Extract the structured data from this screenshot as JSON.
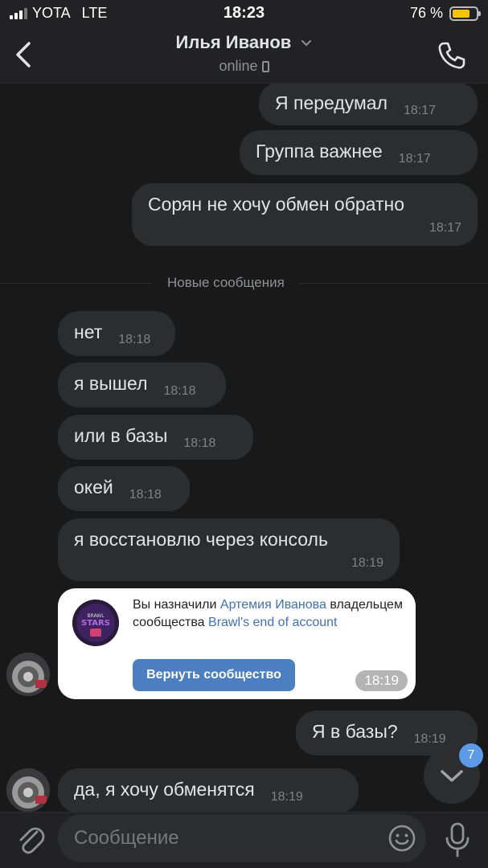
{
  "status_bar": {
    "carrier": "YOTA",
    "network": "LTE",
    "time": "18:23",
    "battery": "76 %",
    "battery_level": 0.76
  },
  "header": {
    "title": "Илья Иванов",
    "status": "online"
  },
  "messages_out_top": [
    {
      "text": "Я передумал",
      "time": "18:17"
    },
    {
      "text": "Группа важнее",
      "time": "18:17"
    },
    {
      "text": "Сорян не хочу обмен обратно",
      "time": "18:17"
    }
  ],
  "divider": "Новые сообщения",
  "messages_in": [
    {
      "text": "нет",
      "time": "18:18"
    },
    {
      "text": "я вышел",
      "time": "18:18"
    },
    {
      "text": "или в базы",
      "time": "18:18"
    },
    {
      "text": "окей",
      "time": "18:18"
    },
    {
      "text": "я восстановлю через консоль",
      "time": "18:19"
    }
  ],
  "card": {
    "text_1": "Вы назначили ",
    "link_1": "Артемия Иванова",
    "text_2": " владельцем сообщества ",
    "link_2": "Brawl's end of account",
    "button": "Вернуть сообщество",
    "time": "18:19"
  },
  "message_out_bottom": {
    "text": "Я в базы?",
    "time": "18:19"
  },
  "message_in_last": {
    "text": "да, я хочу обменятся",
    "time": "18:19"
  },
  "unread_badge": "7",
  "input": {
    "placeholder": "Сообщение"
  },
  "colors": {
    "accent": "#5a9ae6",
    "bubble": "#2c2d2e",
    "background": "#19191a",
    "link": "#3f72b5",
    "button": "#4c7fc2"
  }
}
